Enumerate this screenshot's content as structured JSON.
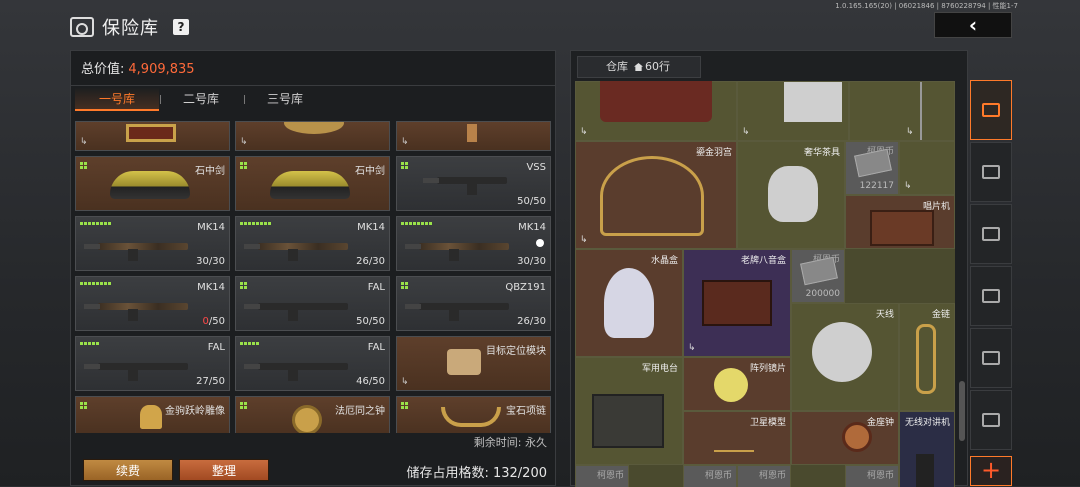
{
  "header": {
    "title": "保险库",
    "help": "?",
    "version": "1.0.165.165(20) | 06021846 | 8760228794 | 性能1-7",
    "back_label": "‹"
  },
  "left": {
    "total_label": "总价值:",
    "total_value": "4,909,835",
    "tabs": [
      {
        "label": "一号库",
        "active": true
      },
      {
        "label": "二号库",
        "active": false
      },
      {
        "label": "三号库",
        "active": false
      }
    ],
    "remaining_label": "剩余时间:  永久",
    "renew_label": "续费",
    "sort_label": "整理",
    "storage_label": "储存占用格数: 132/200",
    "items": [
      {
        "name": "",
        "count": "",
        "color": "brown"
      },
      {
        "name": "",
        "count": "",
        "color": "brown"
      },
      {
        "name": "",
        "count": "",
        "color": "brown"
      },
      {
        "name": "石中剑",
        "count": "",
        "color": "brown"
      },
      {
        "name": "石中剑",
        "count": "",
        "color": "brown"
      },
      {
        "name": "VSS",
        "count": "50/50",
        "color": "gray"
      },
      {
        "name": "MK14",
        "count": "30/30",
        "color": "gray"
      },
      {
        "name": "MK14",
        "count": "26/30",
        "color": "gray"
      },
      {
        "name": "MK14",
        "count": "30/30",
        "color": "gray"
      },
      {
        "name": "MK14",
        "count_red": "0",
        "count_rest": "/50",
        "color": "gray"
      },
      {
        "name": "FAL",
        "count": "50/50",
        "color": "gray"
      },
      {
        "name": "QBZ191",
        "count": "26/30",
        "color": "gray"
      },
      {
        "name": "FAL",
        "count": "27/50",
        "color": "gray"
      },
      {
        "name": "FAL",
        "count": "46/50",
        "color": "gray"
      },
      {
        "name": "目标定位模块",
        "count": "",
        "color": "brown"
      },
      {
        "name": "金驹跃岭雕像",
        "count": "",
        "color": "brown"
      },
      {
        "name": "法厄同之钟",
        "count": "",
        "color": "brown"
      },
      {
        "name": "宝石项链",
        "count": "",
        "color": "brown"
      }
    ]
  },
  "right": {
    "warehouse_tab": "仓库",
    "rows_label": "60行",
    "cells": [
      {
        "name": "鎏金羽宫"
      },
      {
        "name": "奢华茶具"
      },
      {
        "name": "柯恩币",
        "sub": "122117"
      },
      {
        "name": "唱片机"
      },
      {
        "name": "水晶盒"
      },
      {
        "name": "老牌八音盒"
      },
      {
        "name": "柯恩币",
        "sub": "200000"
      },
      {
        "name": "天线"
      },
      {
        "name": "金链"
      },
      {
        "name": "军用电台"
      },
      {
        "name": "阵列镜片"
      },
      {
        "name": "卫星模型"
      },
      {
        "name": "金座钟"
      },
      {
        "name": "无线对讲机"
      },
      {
        "name": "柯恩币"
      },
      {
        "name": "柯恩币"
      },
      {
        "name": "柯恩币"
      },
      {
        "name": "柯恩币"
      }
    ],
    "plus_label": "+"
  },
  "icons": {
    "safe": "safe-icon",
    "home": "home-icon",
    "arrow": "move-arrow-icon",
    "plus": "plus-icon"
  },
  "colors": {
    "accent": "#ff7a2a",
    "total_value": "#ff6a3a",
    "pips": "#9ae24a"
  }
}
